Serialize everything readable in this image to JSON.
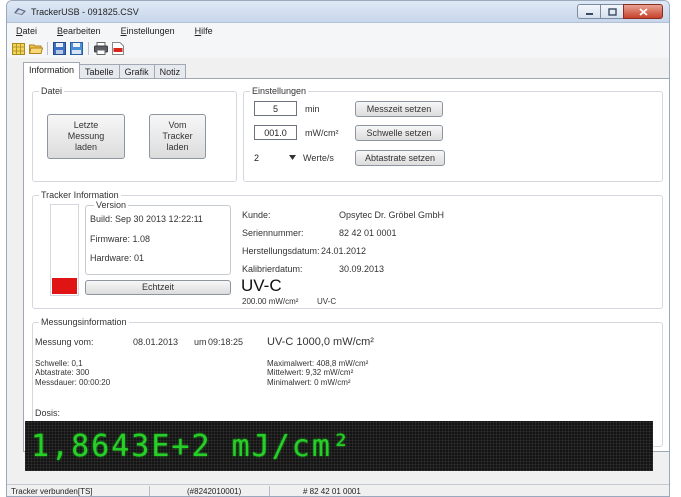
{
  "window": {
    "title": "TrackerUSB - 091825.CSV",
    "controls": {
      "minimize": "minimize-icon",
      "maximize": "maximize-icon",
      "close": "close-icon"
    }
  },
  "menu": [
    "Datei",
    "Bearbeiten",
    "Einstellungen",
    "Hilfe"
  ],
  "toolbar": {
    "icons": [
      "grid-icon",
      "folder-open-icon",
      "save-icon",
      "save-as-icon",
      "print-icon",
      "pdf-icon"
    ]
  },
  "tabs": [
    {
      "label": "Information",
      "active": true
    },
    {
      "label": "Tabelle",
      "active": false
    },
    {
      "label": "Grafik",
      "active": false
    },
    {
      "label": "Notiz",
      "active": false
    }
  ],
  "datei": {
    "title": "Datei",
    "load_last_button": "Letzte Messung laden",
    "load_tracker_button": "Vom Tracker laden"
  },
  "einstellungen": {
    "title": "Einstellungen",
    "measure_time": {
      "value": "5",
      "unit": "min",
      "button": "Messzeit setzen"
    },
    "threshold": {
      "value": "001.0",
      "unit": "mW/cm²",
      "button": "Schwelle setzen"
    },
    "sample_rate": {
      "value": "2",
      "unit": "Werte/s",
      "button": "Abtastrate setzen"
    }
  },
  "tracker": {
    "title": "Tracker Information",
    "version_title": "Version",
    "build": "Build: Sep 30 2013 12:22:11",
    "firmware": "Firmware: 1.08",
    "hardware": "Hardware: 01",
    "realtime_button": "Echtzeit",
    "level_fraction": 0.18,
    "level_color": "#e01414",
    "customer_label": "Kunde:",
    "customer_value": "Opsytec Dr. Gröbel GmbH",
    "serial_label": "Seriennummer:",
    "serial_value": "82 42 01 0001",
    "mfg_date_label": "Herstellungsdatum:",
    "mfg_date_value": "24.01.2012",
    "cal_date_label": "Kalibrierdatum:",
    "cal_date_value": "30.09.2013",
    "sensor_type": "UV-C",
    "sensor_range": "200.00 mW/cm²",
    "sensor_range_type": "UV-C"
  },
  "measurement": {
    "title": "Messungsinformation",
    "date_label": "Messung vom:",
    "date_value": "08.01.2013",
    "time_label": "um",
    "time_value": "09:18:25",
    "sensor_summary": "UV-C 1000,0 mW/cm²",
    "threshold": "Schwelle: 0,1",
    "sample_rate": "Abtastrate: 300",
    "duration": "Messdauer: 00:00:20",
    "max": "Maximalwert: 408,8 mW/cm²",
    "mean": "Mittelwert: 9,32 mW/cm²",
    "min": "Minimalwert: 0 mW/cm²",
    "dose_label": "Dosis:",
    "dose_value": "1,8643E+2 mJ/cm²",
    "display_color": "#26d026"
  },
  "status": {
    "connection": "Tracker verbunden[TS]",
    "id": "(#8242010001)",
    "serial": "# 82 42 01 0001"
  }
}
